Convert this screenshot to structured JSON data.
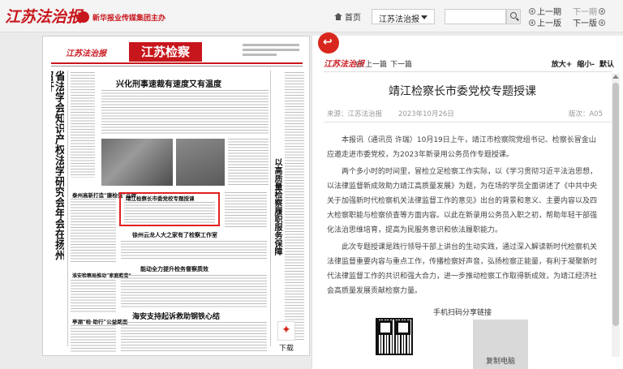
{
  "header": {
    "logo": "江苏法治报",
    "sub_logo": "新华报业传媒集团主办",
    "home": "首页",
    "paper_select": "江苏法治报",
    "search_placeholder": "",
    "nav": {
      "prev_period": "上一期",
      "next_period": "下一期",
      "prev_page": "上一版",
      "next_page": "下一版"
    }
  },
  "newspaper": {
    "logo": "江苏法治报",
    "section": "江苏检察",
    "headline_top": "兴化刑事速裁有速度又有温度",
    "vertical_headline": "省法学会知识产权法学研究会年会在扬州召开",
    "highlighted_headline": "靖江检察长市委党校专题授课",
    "headline_mid": "徐州云龙人大之家有了检察工作室",
    "headline_lower": "能动全力提升检务督察质效",
    "headline_bottom": "海安支持起诉救助钢铁心结",
    "side_vertical": "以高质量检察履职服务保障现代化建设",
    "left_small_1": "泰州高新打造“廉检值”品牌",
    "left_small_2": "淮安检察局推动”家庭教育“",
    "left_small_3": "亭湖“检·助行”公益路面",
    "download": "下载"
  },
  "article": {
    "logo": "江苏法治报",
    "prev": "上一篇",
    "next": "下一篇",
    "zoom_in": "放大+",
    "zoom_out": "缩小-",
    "reset": "默认",
    "title": "靖江检察长市委党校专题授课",
    "source": "来源：江苏法治报",
    "date": "2023年10月26日",
    "page": "版次：A05",
    "paragraphs": [
      "本报讯（通讯员 许瑞）10月19日上午，靖江市检察院党组书记、检察长冒金山应邀走进市委党校，为2023年新录用公务员作专题授课。",
      "两个多小时的时间里，冒检立足检察工作实际，以《学习贯彻习近平法治思想，以法律监督新成效助力靖江高质量发展》为题，为在场的学员全面讲述了《中共中央关于加强新时代检察机关法律监督工作的意见》出台的背景和意义、主要内容以及四大检察职能与检察侦查等方面内容。以此在新录用公务员入职之初，帮助年轻干部强化法治思维培育，提高为民服务意识和依法履职能力。",
      "此次专题授课是践行领导干部上讲台的生动实践，通过深入解读新时代检察机关法律监督重要内容与重点工作，传播检察好声音，弘扬检察正能量，有利于凝聚新时代法律监督工作的共识和强大合力，进一步推动检察工作取得新成效，为靖江经济社会高质量发展贡献检察力量。"
    ],
    "share_label": "手机扫码分享链接",
    "copy_label": "复制电脑"
  }
}
